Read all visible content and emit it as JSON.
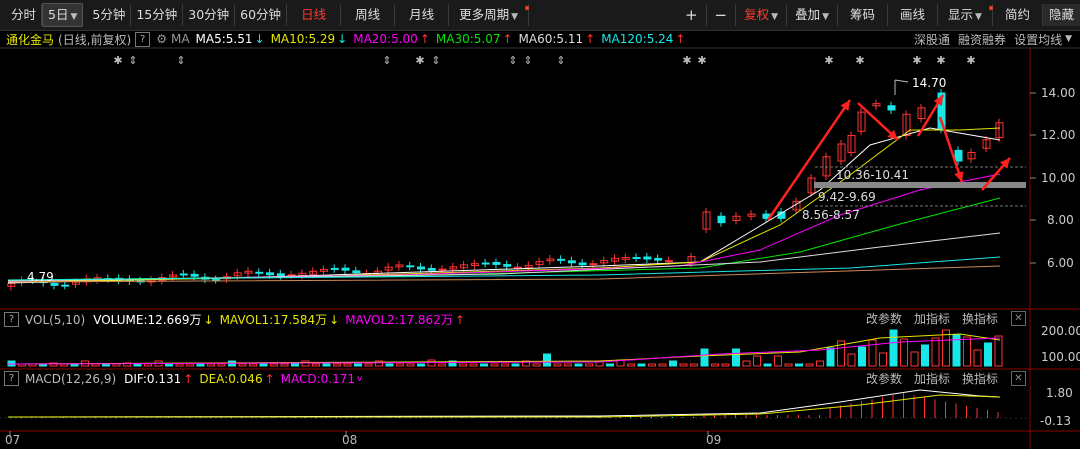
{
  "toolbar": {
    "items": [
      "分时",
      "5日",
      "5分钟",
      "15分钟",
      "30分钟",
      "60分钟",
      "日线",
      "周线",
      "月线",
      "更多周期"
    ],
    "right": [
      "+",
      "−",
      "复权",
      "叠加",
      "筹码",
      "画线",
      "显示",
      "简约",
      "隐藏"
    ]
  },
  "info": {
    "name": "通化金马",
    "mode": "(日线,前复权)",
    "help": "?",
    "ma_label": "MA",
    "ma5": "MA5:5.51",
    "ma10": "MA10:5.29",
    "ma20": "MA20:5.00",
    "ma30": "MA30:5.07",
    "ma60": "MA60:5.11",
    "ma120": "MA120:5.24",
    "right": [
      "深股通",
      "融资融券",
      "设置均线"
    ]
  },
  "price_axis": [
    "14.00",
    "12.00",
    "10.00",
    "8.00",
    "6.00"
  ],
  "annotations": {
    "high": "14.70",
    "low": "4.79",
    "band1": "10.36-10.41",
    "band2": "9.42-9.69",
    "band3": "8.56-8.57"
  },
  "volume": {
    "box": "?",
    "label": "VOL(5,10)",
    "volume": "VOLUME:12.669万",
    "mavol1": "MAVOL1:17.584万",
    "mavol2": "MAVOL2:17.862万",
    "axis": [
      "200.00",
      "100.00"
    ],
    "buttons": [
      "改参数",
      "加指标",
      "换指标"
    ]
  },
  "macd": {
    "box": "?",
    "label": "MACD(12,26,9)",
    "dif": "DIF:0.131",
    "dea": "DEA:0.046",
    "macd": "MACD:0.171",
    "axis": [
      "1.80",
      "-0.13"
    ],
    "buttons": [
      "改参数",
      "加指标",
      "换指标"
    ]
  },
  "xaxis": [
    "07",
    "08",
    "09"
  ],
  "colors": {
    "up": "#ff3232",
    "down": "#19e6e6",
    "ma5": "#ffffff",
    "ma10": "#e6e600",
    "ma20": "#ff00ff",
    "ma30": "#00e600",
    "ma60": "#dddddd",
    "ma120": "#19e6e6"
  }
}
